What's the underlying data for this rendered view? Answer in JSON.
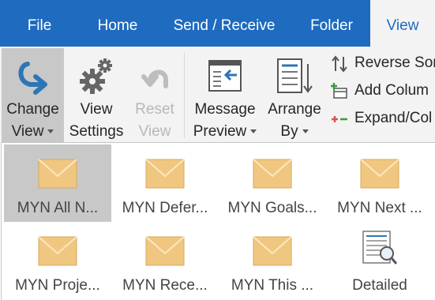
{
  "tabs": [
    "File",
    "Home",
    "Send / Receive",
    "Folder",
    "View"
  ],
  "active_tab": "View",
  "ribbon": {
    "change_view": {
      "line1": "Change",
      "line2": "View"
    },
    "view_settings": {
      "line1": "View",
      "line2": "Settings"
    },
    "reset_view": {
      "line1": "Reset",
      "line2": "View"
    },
    "message_preview": {
      "line1": "Message",
      "line2": "Preview"
    },
    "arrange_by": {
      "line1": "Arrange",
      "line2": "By"
    },
    "reverse_sort": "Reverse Sor",
    "add_columns": "Add Colum",
    "expand_collapse": "Expand/Col"
  },
  "gallery": {
    "items": [
      "MYN All N...",
      "MYN Defer...",
      "MYN Goals...",
      "MYN Next ...",
      "MYN Proje...",
      "MYN Rece...",
      "MYN This ...",
      "Detailed"
    ],
    "selected_index": 0
  },
  "colors": {
    "tab_bar": "#1e6bbf",
    "ribbon_bg": "#f3f3f3",
    "selected": "#c8c8c8",
    "envelope": "#f0c780",
    "change_view_arrow": "#2e75b6",
    "expand_collapse_red": "#d9534f",
    "add_column_green": "#3a9a3a"
  }
}
